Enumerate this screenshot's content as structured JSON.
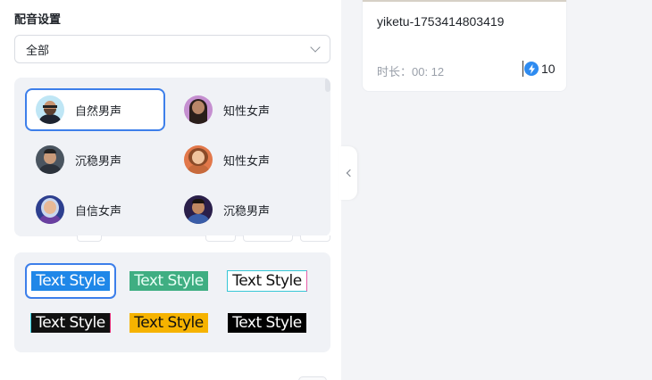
{
  "dubbing": {
    "section_title": "配音设置",
    "filter": {
      "selected": "全部"
    },
    "voices": [
      {
        "label": "自然男声",
        "selected": true
      },
      {
        "label": "知性女声",
        "selected": false
      },
      {
        "label": "沉稳男声",
        "selected": false
      },
      {
        "label": "知性女声",
        "selected": false
      },
      {
        "label": "自信女声",
        "selected": false
      },
      {
        "label": "沉稳男声",
        "selected": false
      }
    ]
  },
  "text_styles": [
    {
      "label": "Text Style",
      "selected": true
    },
    {
      "label": "Text Style",
      "selected": false
    },
    {
      "label": "Text Style",
      "selected": false
    },
    {
      "label": "Text Style",
      "selected": false
    },
    {
      "label": "Text Style",
      "selected": false
    },
    {
      "label": "Text Style",
      "selected": false
    }
  ],
  "card": {
    "name": "yiketu-1753414803419",
    "duration": "时长：00: 12",
    "credits": "10"
  },
  "colors": {
    "accent": "#3d7fea",
    "panel_bg": "#f0f2f6",
    "page_bg": "#f3f4f7",
    "credit_icon": "#2e8bf0"
  }
}
